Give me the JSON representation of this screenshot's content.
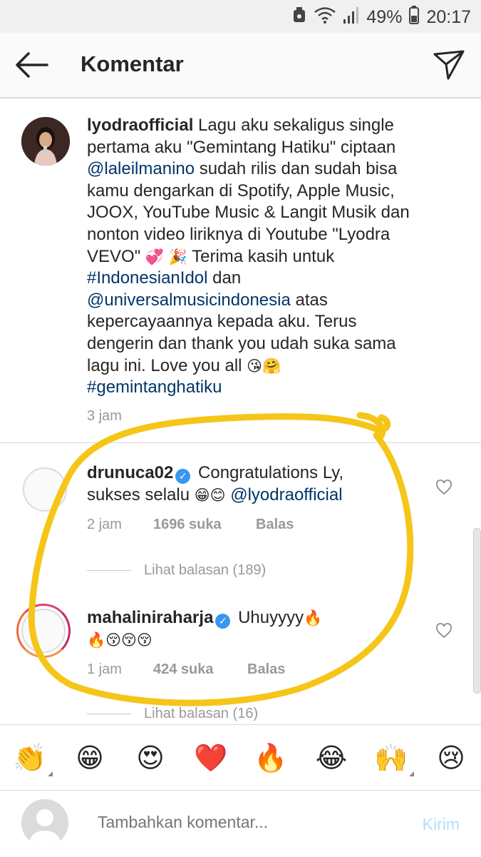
{
  "status_bar": {
    "battery": "49%",
    "time": "20:17",
    "icons": [
      "alarm-icon",
      "wifi-icon",
      "signal-icon",
      "battery-icon"
    ]
  },
  "header": {
    "title": "Komentar",
    "back_icon": "arrow-left-icon",
    "send_icon": "paper-plane-icon"
  },
  "caption": {
    "username": "lyodraofficial",
    "text_1": " Lagu aku sekaligus single pertama aku \"Gemintang Hatiku\" ciptaan ",
    "mention_1": "@laleilmanino",
    "text_2": " sudah rilis dan sudah bisa kamu dengarkan di Spotify, Apple Music, JOOX, YouTube Music & Langit Musik dan nonton video liriknya di Youtube \"Lyodra VEVO\" ",
    "emoji_1": "💞",
    "emoji_2": "🎉",
    "text_3": " Terima kasih untuk ",
    "hashtag_1": "#IndonesianIdol",
    "text_4": " dan ",
    "mention_2": "@universalmusicindonesia",
    "text_5": " atas kepercayaannya kepada aku. Terus dengerin dan thank you udah suka sama lagu ini. Love you all ",
    "emoji_3": "😘🤗",
    "hashtag_2": "#gemintanghatiku",
    "time": "3 jam"
  },
  "comments": [
    {
      "username": "drunuca02",
      "text": " Congratulations Ly, sukses selalu ",
      "emoji": "😁😊",
      "mention": "@lyodraofficial",
      "time": "2 jam",
      "likes": "1696 suka",
      "reply": "Balas",
      "view_replies": "Lihat balasan (189)"
    },
    {
      "username": "mahaliniraharja",
      "text": " Uhuyyyy",
      "emoji": "🔥",
      "emoji_line2": "🔥😚😚😚",
      "time": "1 jam",
      "likes": "424 suka",
      "reply": "Balas",
      "view_replies": "Lihat balasan (16)"
    }
  ],
  "emoji_bar": [
    "👏",
    "😁",
    "😍",
    "❤️",
    "🔥",
    "😂",
    "🙌",
    "😢"
  ],
  "composer": {
    "placeholder": "Tambahkan komentar...",
    "post_label": "Kirim"
  },
  "colors": {
    "link": "#003569",
    "verified": "#3897f0",
    "marker": "#f5c518",
    "post_disabled": "#b2dffc"
  }
}
